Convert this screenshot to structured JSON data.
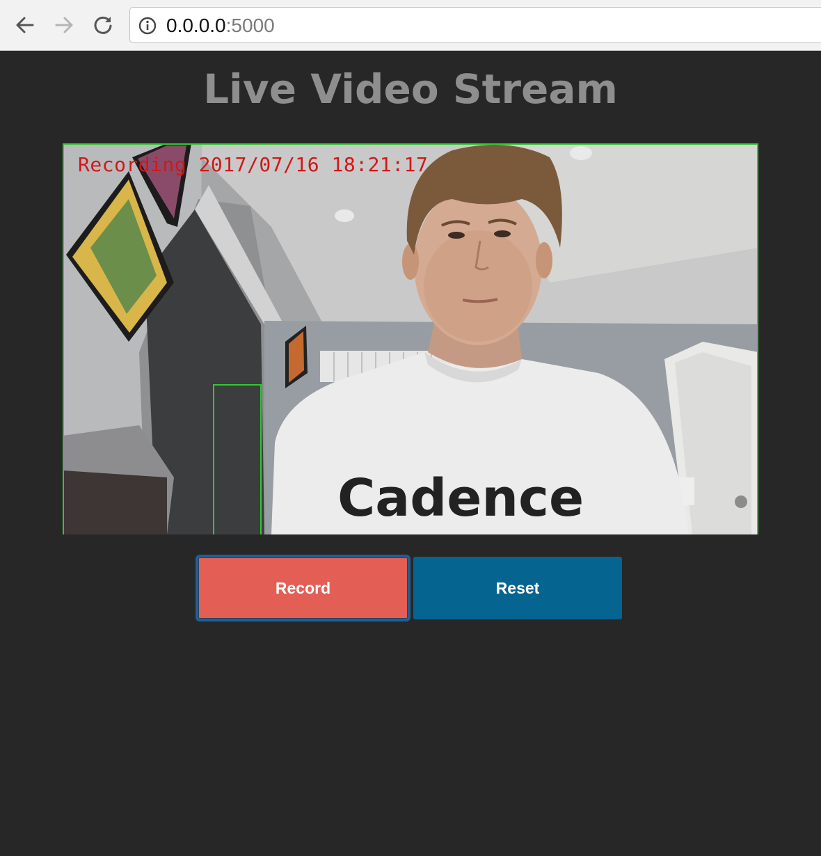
{
  "browser": {
    "address_host": "0.0.0.0",
    "address_port": ":5000",
    "icons": [
      "back-arrow-icon",
      "forward-arrow-icon",
      "reload-icon",
      "info-icon"
    ]
  },
  "page": {
    "title": "Live Video Stream"
  },
  "video": {
    "overlay_text": "Recording 2017/07/16 18:21:17",
    "shirt_text": "Cadence",
    "motion_box_color": "#32c832"
  },
  "controls": {
    "record_label": "Record",
    "reset_label": "Reset",
    "record_color": "#e35f55",
    "reset_color": "#066491"
  }
}
